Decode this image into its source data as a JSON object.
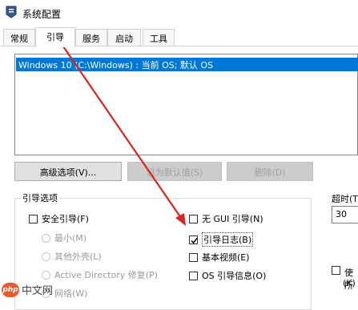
{
  "window": {
    "title": "系统配置"
  },
  "tabs": [
    {
      "label": "常规"
    },
    {
      "label": "引导"
    },
    {
      "label": "服务"
    },
    {
      "label": "启动"
    },
    {
      "label": "工具"
    }
  ],
  "boot_list": {
    "entries": [
      "Windows 10 (C:\\Windows) : 当前 OS; 默认 OS"
    ]
  },
  "buttons": {
    "advanced": "高级选项(V)...",
    "set_default": "设为默认值(S)",
    "delete": "删除(D)"
  },
  "boot_options": {
    "title": "引导选项",
    "safe_boot": "安全引导(F)",
    "minimal": "最小(M)",
    "alternate_shell": "其他外壳(L)",
    "active_directory": "Active Directory 修复(P)",
    "network": "网络(W)",
    "no_gui": "无 GUI 引导(N)",
    "boot_log": "引导日志(B)",
    "base_video": "基本视频(E)",
    "os_info": "OS 引导信息(O)",
    "boot_log_checked": true
  },
  "timeout": {
    "label": "超时(T",
    "value": "30"
  },
  "make_permanent": {
    "label": "使所",
    "hotkey": "(K)"
  },
  "annotation": {
    "arrow_color": "#d9261c"
  },
  "watermark": {
    "text": "中文网",
    "logo": "php"
  }
}
